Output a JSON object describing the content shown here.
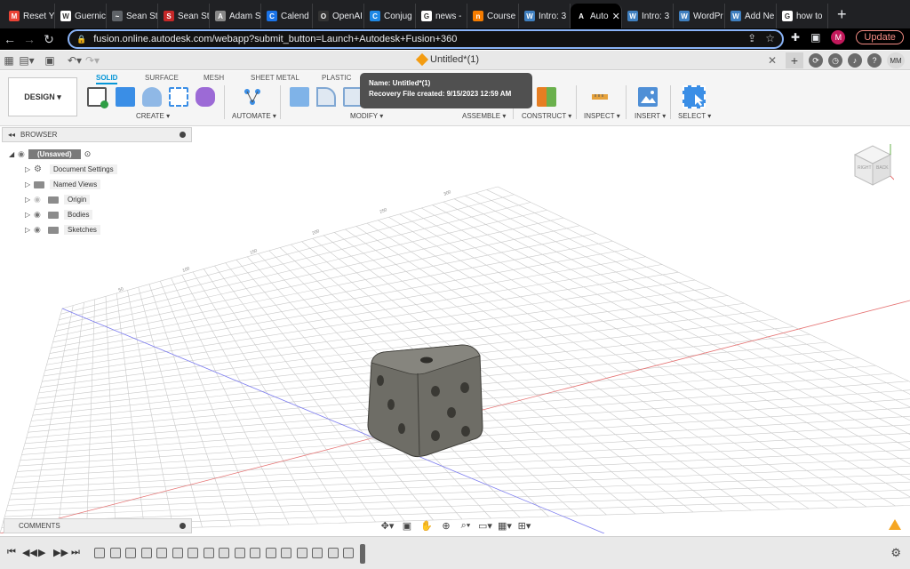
{
  "browser": {
    "tabs": [
      {
        "label": "Reset Y",
        "favicon": "gmail-icon",
        "color": "#ea4335",
        "letter": "M"
      },
      {
        "label": "Guernic",
        "favicon": "wikipedia-icon",
        "color": "#ffffff",
        "letter": "W"
      },
      {
        "label": "Sean St",
        "favicon": "site-icon",
        "color": "#5f6368",
        "letter": "~"
      },
      {
        "label": "Sean St",
        "favicon": "site-icon",
        "color": "#c62828",
        "letter": "S"
      },
      {
        "label": "Adam S",
        "favicon": "site-icon",
        "color": "#888888",
        "letter": "A"
      },
      {
        "label": "Calend",
        "favicon": "calendar-icon",
        "color": "#1a73e8",
        "letter": "C"
      },
      {
        "label": "OpenAI",
        "favicon": "openai-icon",
        "color": "#333333",
        "letter": "O"
      },
      {
        "label": "Conjug",
        "favicon": "site-icon",
        "color": "#1e88e5",
        "letter": "C"
      },
      {
        "label": "news -",
        "favicon": "google-icon",
        "color": "#ffffff",
        "letter": "G"
      },
      {
        "label": "Course",
        "favicon": "site-icon",
        "color": "#f57c00",
        "letter": "n"
      },
      {
        "label": "Intro: 3",
        "favicon": "wordpress-icon",
        "color": "#3f7fbf",
        "letter": "W"
      },
      {
        "label": "Auto",
        "favicon": "autodesk-icon",
        "color": "#000000",
        "letter": "A",
        "active": true
      },
      {
        "label": "Intro: 3",
        "favicon": "wordpress-icon",
        "color": "#3f7fbf",
        "letter": "W"
      },
      {
        "label": "WordPr",
        "favicon": "wordpress-icon",
        "color": "#3f7fbf",
        "letter": "W"
      },
      {
        "label": "Add Ne",
        "favicon": "wordpress-icon",
        "color": "#3f7fbf",
        "letter": "W"
      },
      {
        "label": "how to",
        "favicon": "google-icon",
        "color": "#ffffff",
        "letter": "G"
      }
    ],
    "url": "fusion.online.autodesk.com/webapp?submit_button=Launch+Autodesk+Fusion+360",
    "profile_letter": "M",
    "update_label": "Update"
  },
  "app": {
    "doc_title": "Untitled*(1)",
    "user_initials": "MM"
  },
  "ribbon": {
    "design_label": "DESIGN ▾",
    "tabs": [
      "SOLID",
      "SURFACE",
      "MESH",
      "SHEET METAL",
      "PLASTIC"
    ],
    "groups": [
      "CREATE ▾",
      "AUTOMATE ▾",
      "MODIFY ▾",
      "ASSEMBLE ▾",
      "CONSTRUCT ▾",
      "INSPECT ▾",
      "INSERT ▾",
      "SELECT ▾"
    ],
    "tooltip_name": "Name: Untitled*(1)",
    "tooltip_recovery": "Recovery File created: 9/15/2023 12:59 AM"
  },
  "browser_panel": {
    "title": "BROWSER",
    "root": "(Unsaved)",
    "items": [
      "Document Settings",
      "Named Views",
      "Origin",
      "Bodies",
      "Sketches"
    ]
  },
  "viewcube": {
    "right": "RIGHT",
    "back": "BACK"
  },
  "grid_labels": [
    "250",
    "200",
    "150",
    "100",
    "50",
    "300"
  ],
  "comments": {
    "title": "COMMENTS"
  },
  "colors": {
    "accent": "#0696d7",
    "x_axis": "#e57373",
    "y_axis": "#7c7cf0",
    "die": "#6e6d66"
  }
}
